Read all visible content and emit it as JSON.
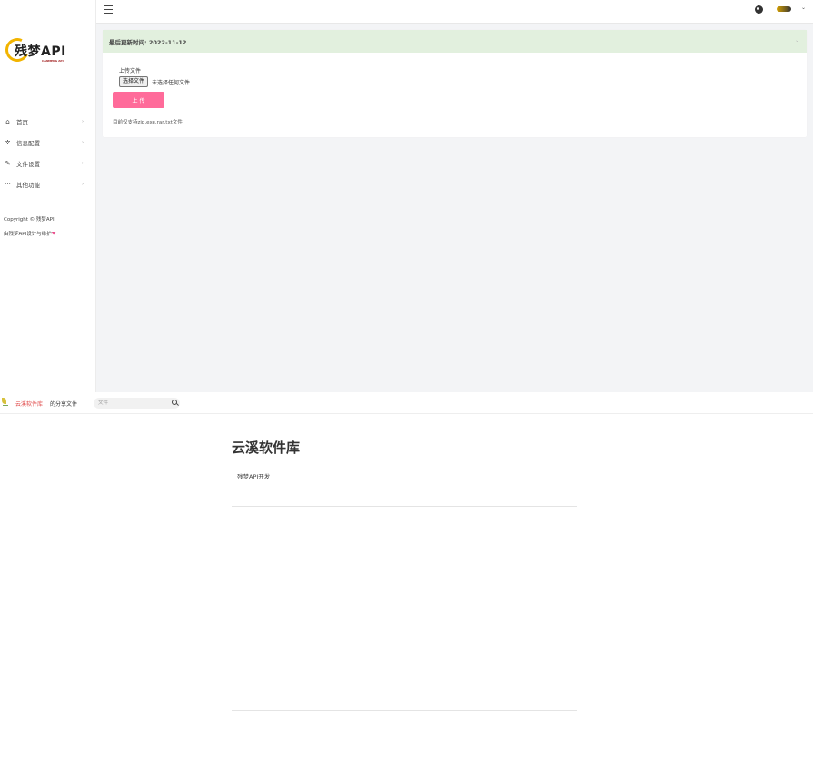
{
  "colors": {
    "accent_pink": "#ff6b9a",
    "header_green": "#e2f0de",
    "brand_red": "#e04a4a",
    "logo_gold": "#f2b400",
    "heart": "#e94b8a"
  },
  "sidebar": {
    "logo": {
      "name": "残梦API",
      "sub": "CANMENG API"
    },
    "items": [
      {
        "icon": "home-icon",
        "glyph": "⌂",
        "label": "首页"
      },
      {
        "icon": "gear-icon",
        "glyph": "✲",
        "label": "信息配置"
      },
      {
        "icon": "pencil-icon",
        "glyph": "✎",
        "label": "文件设置"
      },
      {
        "icon": "more-icon",
        "glyph": "···",
        "label": "其他功能"
      }
    ],
    "copyright": "Copyright © 残梦API",
    "credit_text": "由残梦API设计与维护",
    "credit_heart": "❤"
  },
  "topbar": {
    "caret": "⌄"
  },
  "card": {
    "title": "最后更新时间: 2022-11-12",
    "collapse_glyph": "⌄",
    "upload_label": "上传文件",
    "file_button": "选择文件",
    "file_status": "未选择任何文件",
    "submit_label": "上 传",
    "hint": "目前仅支持zip,exe,rar,txt文件"
  },
  "share": {
    "brand": "云溪软件库",
    "nav_link": "的分享文件",
    "search": {
      "placeholder": "文件"
    },
    "title": "云溪软件库",
    "description": "残梦API开发"
  }
}
